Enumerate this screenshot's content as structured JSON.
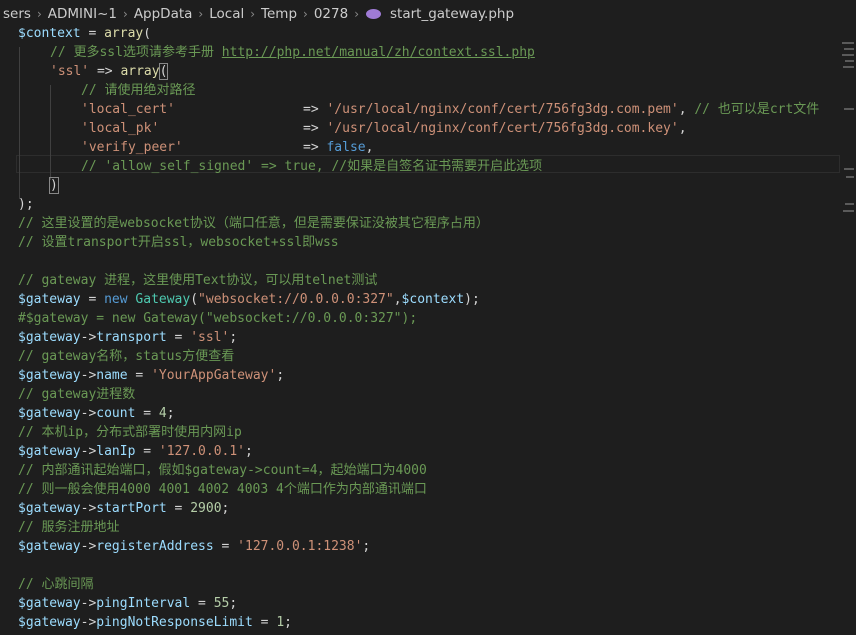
{
  "breadcrumb": {
    "items": [
      "sers",
      "ADMINI~1",
      "AppData",
      "Local",
      "Temp",
      "0278"
    ],
    "file": "start_gateway.php",
    "separator": "›"
  },
  "code": {
    "l1_var": "$context",
    "l1_eq": " = ",
    "l1_fn": "array",
    "l1_paren": "(",
    "l2_comment": "// 更多ssl选项请参考手册 ",
    "l2_url": "http://php.net/manual/zh/context.ssl.php",
    "l3_key": "'ssl'",
    "l3_arrow": " => ",
    "l3_fn": "array",
    "l3_paren": "(",
    "l4_comment": "// 请使用绝对路径",
    "l5_key": "'local_cert'",
    "l5_arrow": "=> ",
    "l5_val": "'/usr/local/nginx/conf/cert/756fg3dg.com.pem'",
    "l5_comma": ", ",
    "l5_comment": "// 也可以是crt文件",
    "l6_key": "'local_pk'",
    "l6_arrow": "=> ",
    "l6_val": "'/usr/local/nginx/conf/cert/756fg3dg.com.key'",
    "l6_comma": ",",
    "l7_key": "'verify_peer'",
    "l7_arrow": "=> ",
    "l7_val": "false",
    "l7_comma": ",",
    "l8_comment": "// 'allow_self_signed' => true, //如果是自签名证书需要开启此选项",
    "l9_paren": ")",
    "l10_text": ");",
    "l11_comment": "// 这里设置的是websocket协议（端口任意，但是需要保证没被其它程序占用）",
    "l12_comment": "// 设置transport开启ssl，websocket+ssl即wss",
    "l14_comment": "// gateway 进程，这里使用Text协议，可以用telnet测试",
    "l15_var": "$gateway",
    "l15_eq": " = ",
    "l15_new": "new",
    "l15_cls": " Gateway",
    "l15_p1": "(",
    "l15_str": "\"websocket://0.0.0.0:327\"",
    "l15_comma": ",",
    "l15_var2": "$context",
    "l15_end": ");",
    "l16_comment": "#$gateway = new Gateway(\"websocket://0.0.0.0:327\");",
    "l17_var": "$gateway",
    "l17_arrow": "->",
    "l17_prop": "transport",
    "l17_eq": " = ",
    "l17_val": "'ssl'",
    "l17_end": ";",
    "l18_comment": "// gateway名称，status方便查看",
    "l19_var": "$gateway",
    "l19_arrow": "->",
    "l19_prop": "name",
    "l19_eq": " = ",
    "l19_val": "'YourAppGateway'",
    "l19_end": ";",
    "l20_comment": "// gateway进程数",
    "l21_var": "$gateway",
    "l21_arrow": "->",
    "l21_prop": "count",
    "l21_eq": " = ",
    "l21_val": "4",
    "l21_end": ";",
    "l22_comment": "// 本机ip，分布式部署时使用内网ip",
    "l23_var": "$gateway",
    "l23_arrow": "->",
    "l23_prop": "lanIp",
    "l23_eq": " = ",
    "l23_val": "'127.0.0.1'",
    "l23_end": ";",
    "l24_comment": "// 内部通讯起始端口，假如$gateway->count=4，起始端口为4000",
    "l25_comment": "// 则一般会使用4000 4001 4002 4003 4个端口作为内部通讯端口",
    "l26_var": "$gateway",
    "l26_arrow": "->",
    "l26_prop": "startPort",
    "l26_eq": " = ",
    "l26_val": "2900",
    "l26_end": ";",
    "l27_comment": "// 服务注册地址",
    "l28_var": "$gateway",
    "l28_arrow": "->",
    "l28_prop": "registerAddress",
    "l28_eq": " = ",
    "l28_val": "'127.0.0.1:1238'",
    "l28_end": ";",
    "l30_comment": "// 心跳间隔",
    "l31_var": "$gateway",
    "l31_arrow": "->",
    "l31_prop": "pingInterval",
    "l31_eq": " = ",
    "l31_val": "55",
    "l31_end": ";",
    "l32_var": "$gateway",
    "l32_arrow": "->",
    "l32_prop": "pingNotResponseLimit",
    "l32_eq": " = ",
    "l32_val": "1",
    "l32_end": ";"
  },
  "colors": {
    "background": "#1e1e1e",
    "variable": "#9cdcfe",
    "string": "#ce9178",
    "comment": "#6a9955",
    "keyword": "#569cd6",
    "function": "#dcdcaa",
    "class": "#4ec9b0",
    "number": "#b5cea8"
  }
}
